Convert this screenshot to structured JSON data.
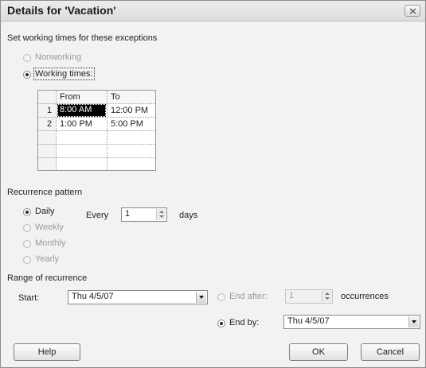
{
  "title": "Details for 'Vacation'",
  "exceptions": {
    "heading": "Set working times for these exceptions",
    "nonworking_label": "Nonworking",
    "working_times_label": "Working times:",
    "selected": "working_times"
  },
  "times_table": {
    "columns": [
      "From",
      "To"
    ],
    "rows": [
      {
        "num": "1",
        "from": "8:00 AM",
        "to": "12:00 PM"
      },
      {
        "num": "2",
        "from": "1:00 PM",
        "to": "5:00 PM"
      },
      {
        "num": "",
        "from": "",
        "to": ""
      },
      {
        "num": "",
        "from": "",
        "to": ""
      },
      {
        "num": "",
        "from": "",
        "to": ""
      }
    ]
  },
  "recurrence": {
    "heading": "Recurrence pattern",
    "options": [
      "Daily",
      "Weekly",
      "Monthly",
      "Yearly"
    ],
    "selected": "Daily",
    "every_label": "Every",
    "every_value": "1",
    "days_label": "days"
  },
  "range": {
    "heading": "Range of recurrence",
    "start_label": "Start:",
    "start_value": "Thu 4/5/07",
    "end_after_label": "End after:",
    "end_after_value": "1",
    "occurrences_label": "occurrences",
    "end_by_label": "End by:",
    "end_by_value": "Thu 4/5/07",
    "selected": "end_by"
  },
  "buttons": {
    "help": "Help",
    "ok": "OK",
    "cancel": "Cancel"
  }
}
